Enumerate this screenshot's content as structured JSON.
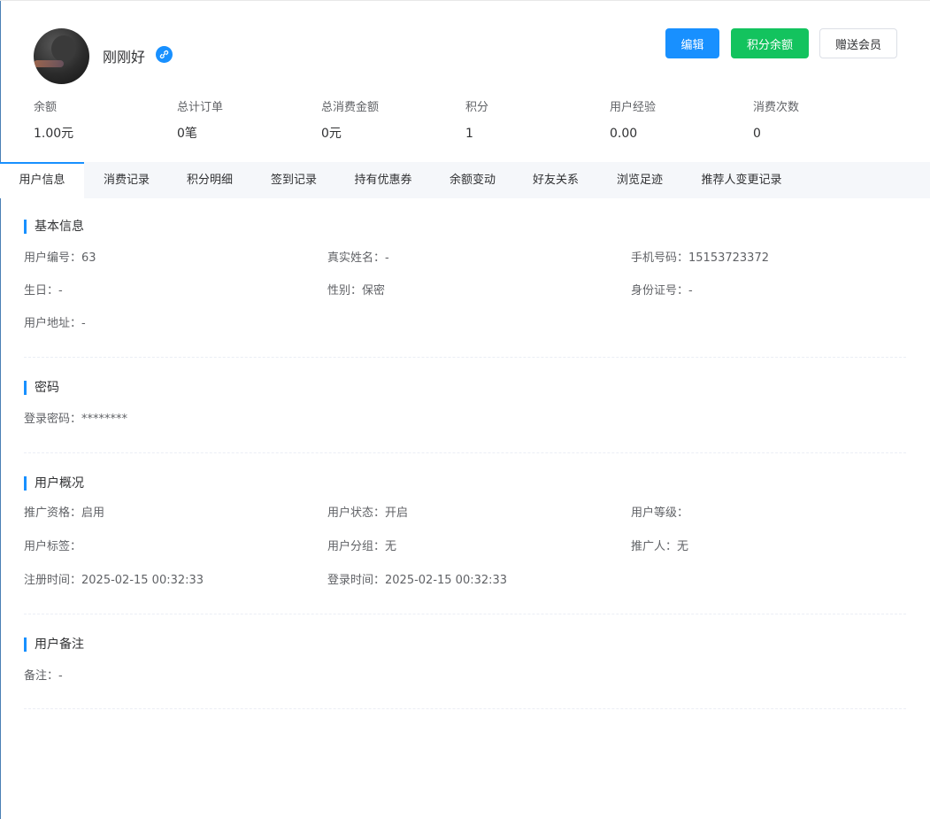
{
  "user": {
    "name": "刚刚好"
  },
  "actions": {
    "edit": "编辑",
    "points_balance": "积分余额",
    "gift_member": "赠送会员"
  },
  "stats": [
    {
      "label": "余额",
      "value": "1.00元"
    },
    {
      "label": "总计订单",
      "value": "0笔"
    },
    {
      "label": "总消费金额",
      "value": "0元"
    },
    {
      "label": "积分",
      "value": "1"
    },
    {
      "label": "用户经验",
      "value": "0.00"
    },
    {
      "label": "消费次数",
      "value": "0"
    }
  ],
  "tabs": [
    "用户信息",
    "消费记录",
    "积分明细",
    "签到记录",
    "持有优惠券",
    "余额变动",
    "好友关系",
    "浏览足迹",
    "推荐人变更记录"
  ],
  "sections": {
    "basic": {
      "title": "基本信息",
      "fields": [
        "用户编号：63",
        "真实姓名：-",
        "手机号码：15153723372",
        "生日：-",
        "性别：保密",
        "身份证号：-",
        "用户地址：-"
      ]
    },
    "password": {
      "title": "密码",
      "fields": [
        "登录密码：********"
      ]
    },
    "overview": {
      "title": "用户概况",
      "fields": [
        "推广资格：启用",
        "用户状态：开启",
        "用户等级：",
        "用户标签：",
        "用户分组：无",
        "推广人：无",
        "注册时间：2025-02-15 00:32:33",
        "登录时间：2025-02-15 00:32:33"
      ]
    },
    "remark": {
      "title": "用户备注",
      "fields": [
        "备注：-"
      ]
    }
  },
  "colors": {
    "primary": "#1890ff",
    "success": "#13c35e",
    "tab_bar_bg": "#f5f7fa"
  },
  "icons": {
    "link_badge": "link-icon"
  }
}
